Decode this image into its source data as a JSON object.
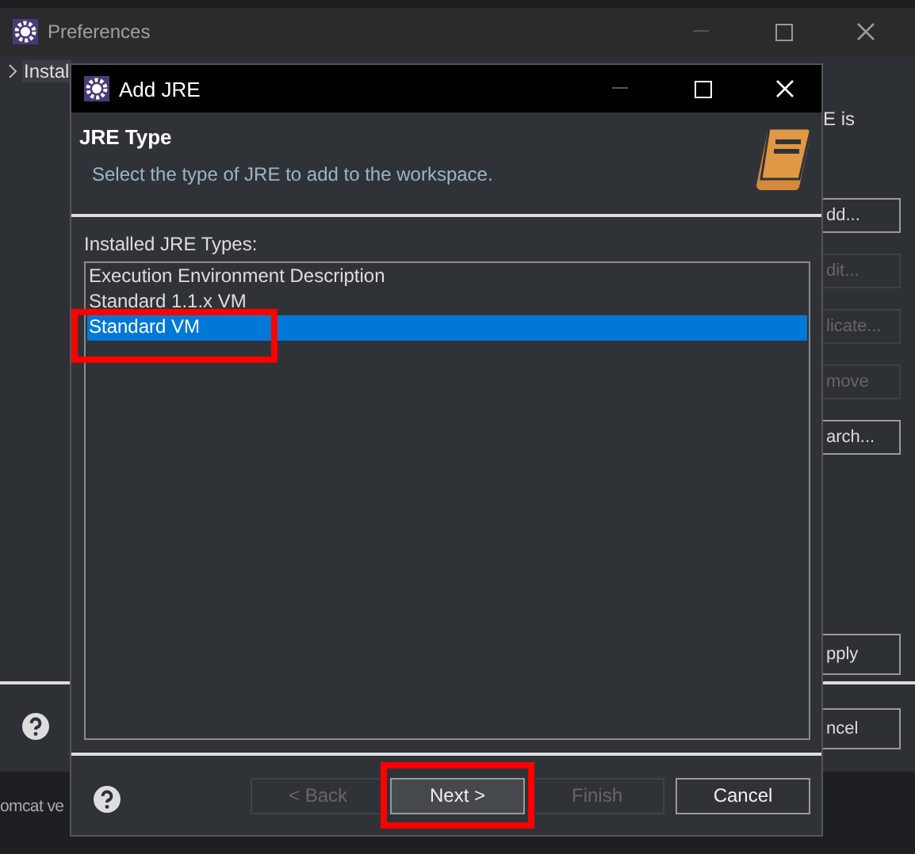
{
  "preferences": {
    "title": "Preferences",
    "tree_item": "Instal",
    "side_text": "E is",
    "buttons": [
      {
        "label": "dd...",
        "disabled": false
      },
      {
        "label": "dit...",
        "disabled": true
      },
      {
        "label": "licate...",
        "disabled": true
      },
      {
        "label": "move",
        "disabled": true
      },
      {
        "label": "arch...",
        "disabled": false
      }
    ],
    "apply": "pply",
    "cancel": "ncel",
    "behind_text": "omcat ve"
  },
  "dialog": {
    "title": "Add JRE",
    "heading": "JRE Type",
    "description": "Select the type of JRE to add to the workspace.",
    "list_label": "Installed JRE Types:",
    "types": [
      {
        "label": "Execution Environment Description",
        "selected": false
      },
      {
        "label": "Standard 1.1.x VM",
        "selected": false
      },
      {
        "label": "Standard VM",
        "selected": true
      }
    ],
    "buttons": [
      {
        "label": "< Back",
        "disabled": true,
        "default": false
      },
      {
        "label": "Next >",
        "disabled": false,
        "default": true
      },
      {
        "label": "Finish",
        "disabled": true,
        "default": false
      },
      {
        "label": "Cancel",
        "disabled": false,
        "default": false
      }
    ]
  }
}
